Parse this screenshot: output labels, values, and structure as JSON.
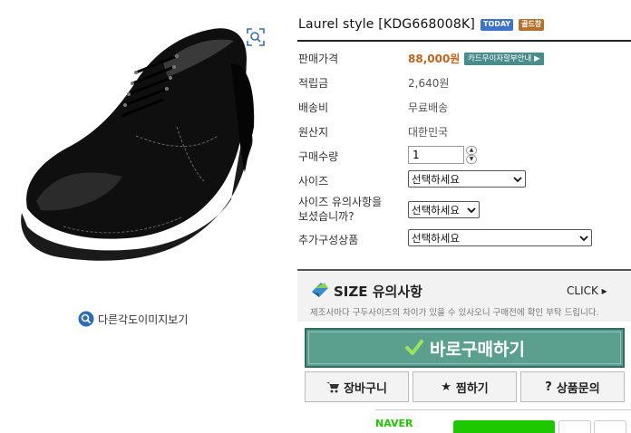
{
  "product": {
    "title": "Laurel style [KDG668008K]",
    "badges": [
      "TODAY",
      "골드창"
    ]
  },
  "info": {
    "price_label": "판매가격",
    "price_value": "88,000원",
    "card_button": "카드무이자할부안내 ▶",
    "points_label": "적립금",
    "points_value": "2,640원",
    "shipping_label": "배송비",
    "shipping_value": "무료배송",
    "origin_label": "원산지",
    "origin_value": "대한민국",
    "qty_label": "구매수량",
    "qty_value": "1",
    "size_label": "사이즈",
    "size_select": "선택하세요",
    "size_notice_label": "사이즈 유의사항을\n보셨습니까?",
    "size_notice_select": "선택하세요",
    "addon_label": "추가구성상품",
    "addon_select": "선택하세요"
  },
  "size_notice": {
    "title": "SIZE 유의사항",
    "click": "CLICK ▸",
    "desc": "제조사마다 구두사이즈의 차이가 있을 수 있사오니 구매전에 확인 부탁 드립니다."
  },
  "actions": {
    "buy": "바로구매하기",
    "cart": "장바구니",
    "wish": "찜하기",
    "inquiry": "상품문의"
  },
  "alt_view": "다른각도이미지보기",
  "naver": "NAVER",
  "colors": {
    "price": "#c0631a",
    "buy_bg": "#5b9f8e",
    "card_btn": "#4a8b8b",
    "naver_green": "#1ec800"
  }
}
